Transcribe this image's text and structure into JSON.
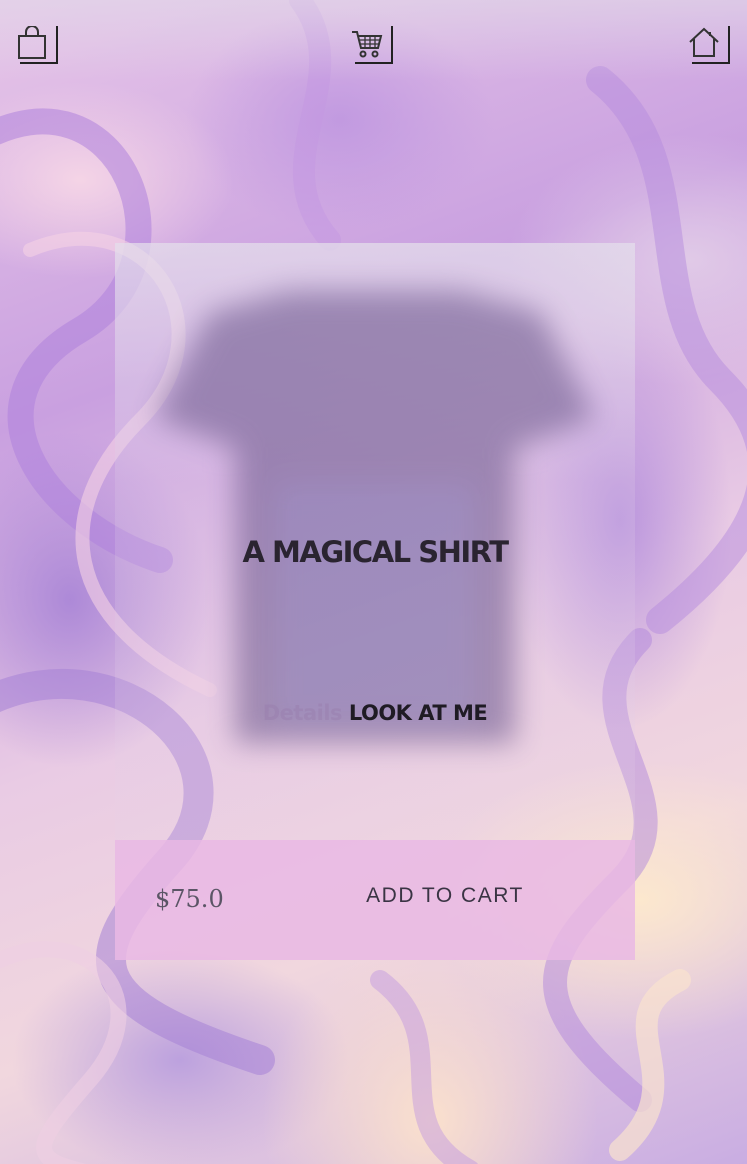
{
  "nav": {
    "left_icon": "shopping-bag-icon",
    "middle_icon": "shopping-cart-icon",
    "right_icon": "home-icon"
  },
  "product": {
    "title": "A MAGICAL SHIRT",
    "details_label": "Details",
    "look_link": "LOOK AT ME",
    "price": "$75.0",
    "add_to_cart": "ADD TO CART"
  },
  "colors": {
    "price_bar": "#e9b9e4",
    "text_dark": "#2a2430"
  }
}
